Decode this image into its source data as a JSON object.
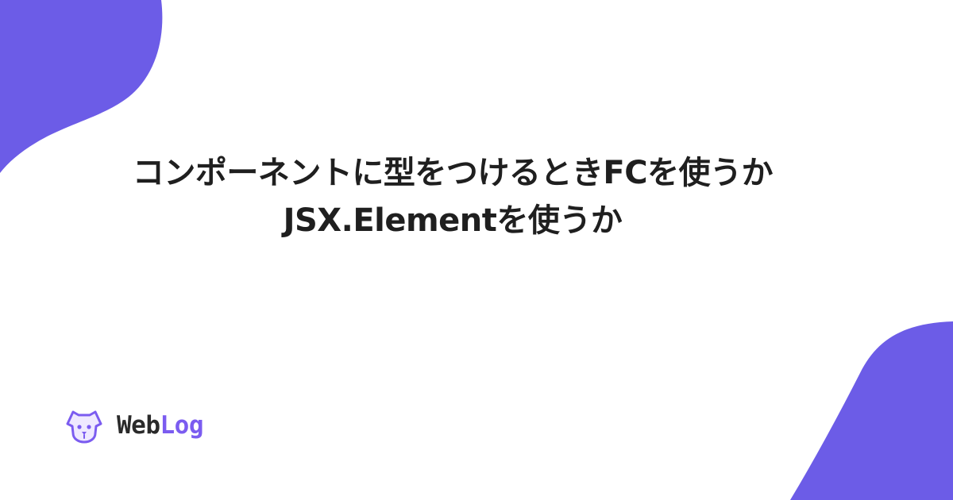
{
  "colors": {
    "background": "#ffffff",
    "accent": "#6c5ce7",
    "title_text": "#1f1f1f",
    "brand_dark": "#2a2a2a",
    "brand_accent": "#7b5cf0"
  },
  "title": {
    "line1": "コンポーネントに型をつけるときFCを使うか",
    "line2": "JSX.Elementを使うか"
  },
  "brand": {
    "logo_icon": "dog-face-icon",
    "name_part1": "Web",
    "name_part2": "Log"
  }
}
